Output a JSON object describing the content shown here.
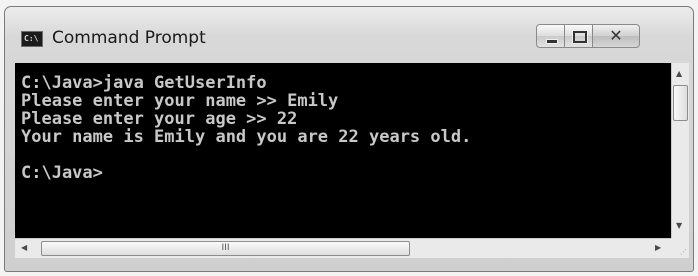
{
  "window": {
    "title": "Command Prompt",
    "icon_text": "C:\\",
    "controls": [
      "minimize-icon",
      "maximize-icon",
      "close-icon"
    ],
    "close_glyph": "✕"
  },
  "console": {
    "lines": [
      "C:\\Java>java GetUserInfo",
      "Please enter your name >> Emily",
      "Please enter your age >> 22",
      "Your name is Emily and you are 22 years old.",
      "",
      "C:\\Java>"
    ],
    "background": "#000000",
    "text_color": "#c8c8c8"
  },
  "scrollbars": {
    "up_arrow": "▲",
    "down_arrow": "▼",
    "left_arrow": "◀",
    "right_arrow": "▶",
    "h_grip": "III"
  }
}
